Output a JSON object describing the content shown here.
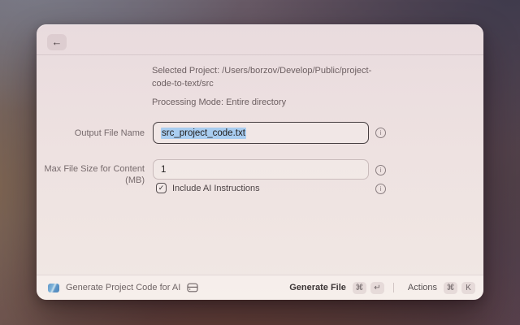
{
  "window": {
    "back_glyph": "←"
  },
  "summary": {
    "selected_project": "Selected Project: /Users/borzov/Develop/Public/project-code-to-text/src",
    "processing_mode": "Processing Mode: Entire directory"
  },
  "form": {
    "output_file": {
      "label": "Output File Name",
      "value": "src_project_code.txt",
      "value_selected": true
    },
    "max_file_size": {
      "label": "Max File Size for Content (MB)",
      "value": "1"
    },
    "include_ai": {
      "label": "Include AI Instructions",
      "checked": true,
      "check_glyph": "✓"
    },
    "info_glyph": "i"
  },
  "footer": {
    "command_title": "Generate Project Code for AI",
    "primary_action": {
      "label": "Generate File",
      "keys": [
        "⌘",
        "↵"
      ]
    },
    "secondary_action": {
      "label": "Actions",
      "keys": [
        "⌘",
        "K"
      ]
    }
  },
  "colors": {
    "selection_highlight": "#a9cdf0",
    "focused_border": "#463e40",
    "app_icon_blue": "#5f96c8",
    "window_bg_top": "#e9dbde",
    "window_bg_bottom": "#f1e8e4"
  }
}
